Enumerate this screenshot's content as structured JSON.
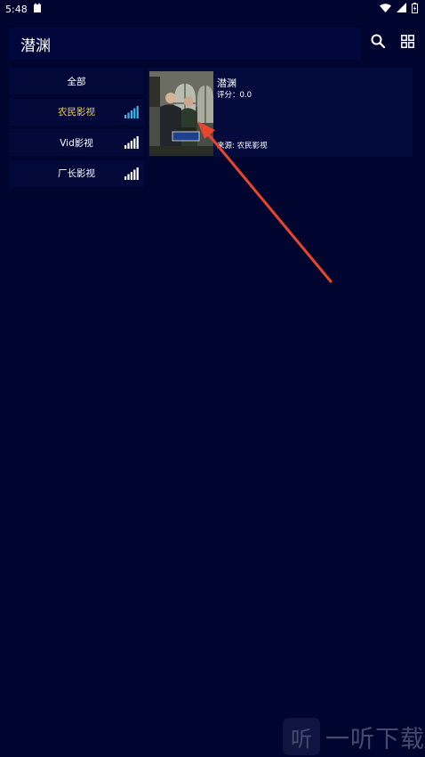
{
  "status": {
    "time": "5:48"
  },
  "header": {
    "title": "潜渊"
  },
  "sidebar": {
    "items": [
      {
        "label": "全部",
        "active": false,
        "signal": false
      },
      {
        "label": "农民影视",
        "active": true,
        "signal": true,
        "signal_color": "#3fb7e6"
      },
      {
        "label": "Vid影视",
        "active": false,
        "signal": true,
        "signal_color": "#ffffff"
      },
      {
        "label": "厂长影视",
        "active": false,
        "signal": true,
        "signal_color": "#ffffff"
      }
    ]
  },
  "result": {
    "title": "潜渊",
    "score": "评分：0.0",
    "source": "来源:  农民影视"
  },
  "colors": {
    "background": "#000530",
    "panel": "#030a3c",
    "active_text": "#f2d24a",
    "annotation_arrow": "#e8452c"
  },
  "watermark": {
    "glyph": "听",
    "text": "一听下载"
  }
}
